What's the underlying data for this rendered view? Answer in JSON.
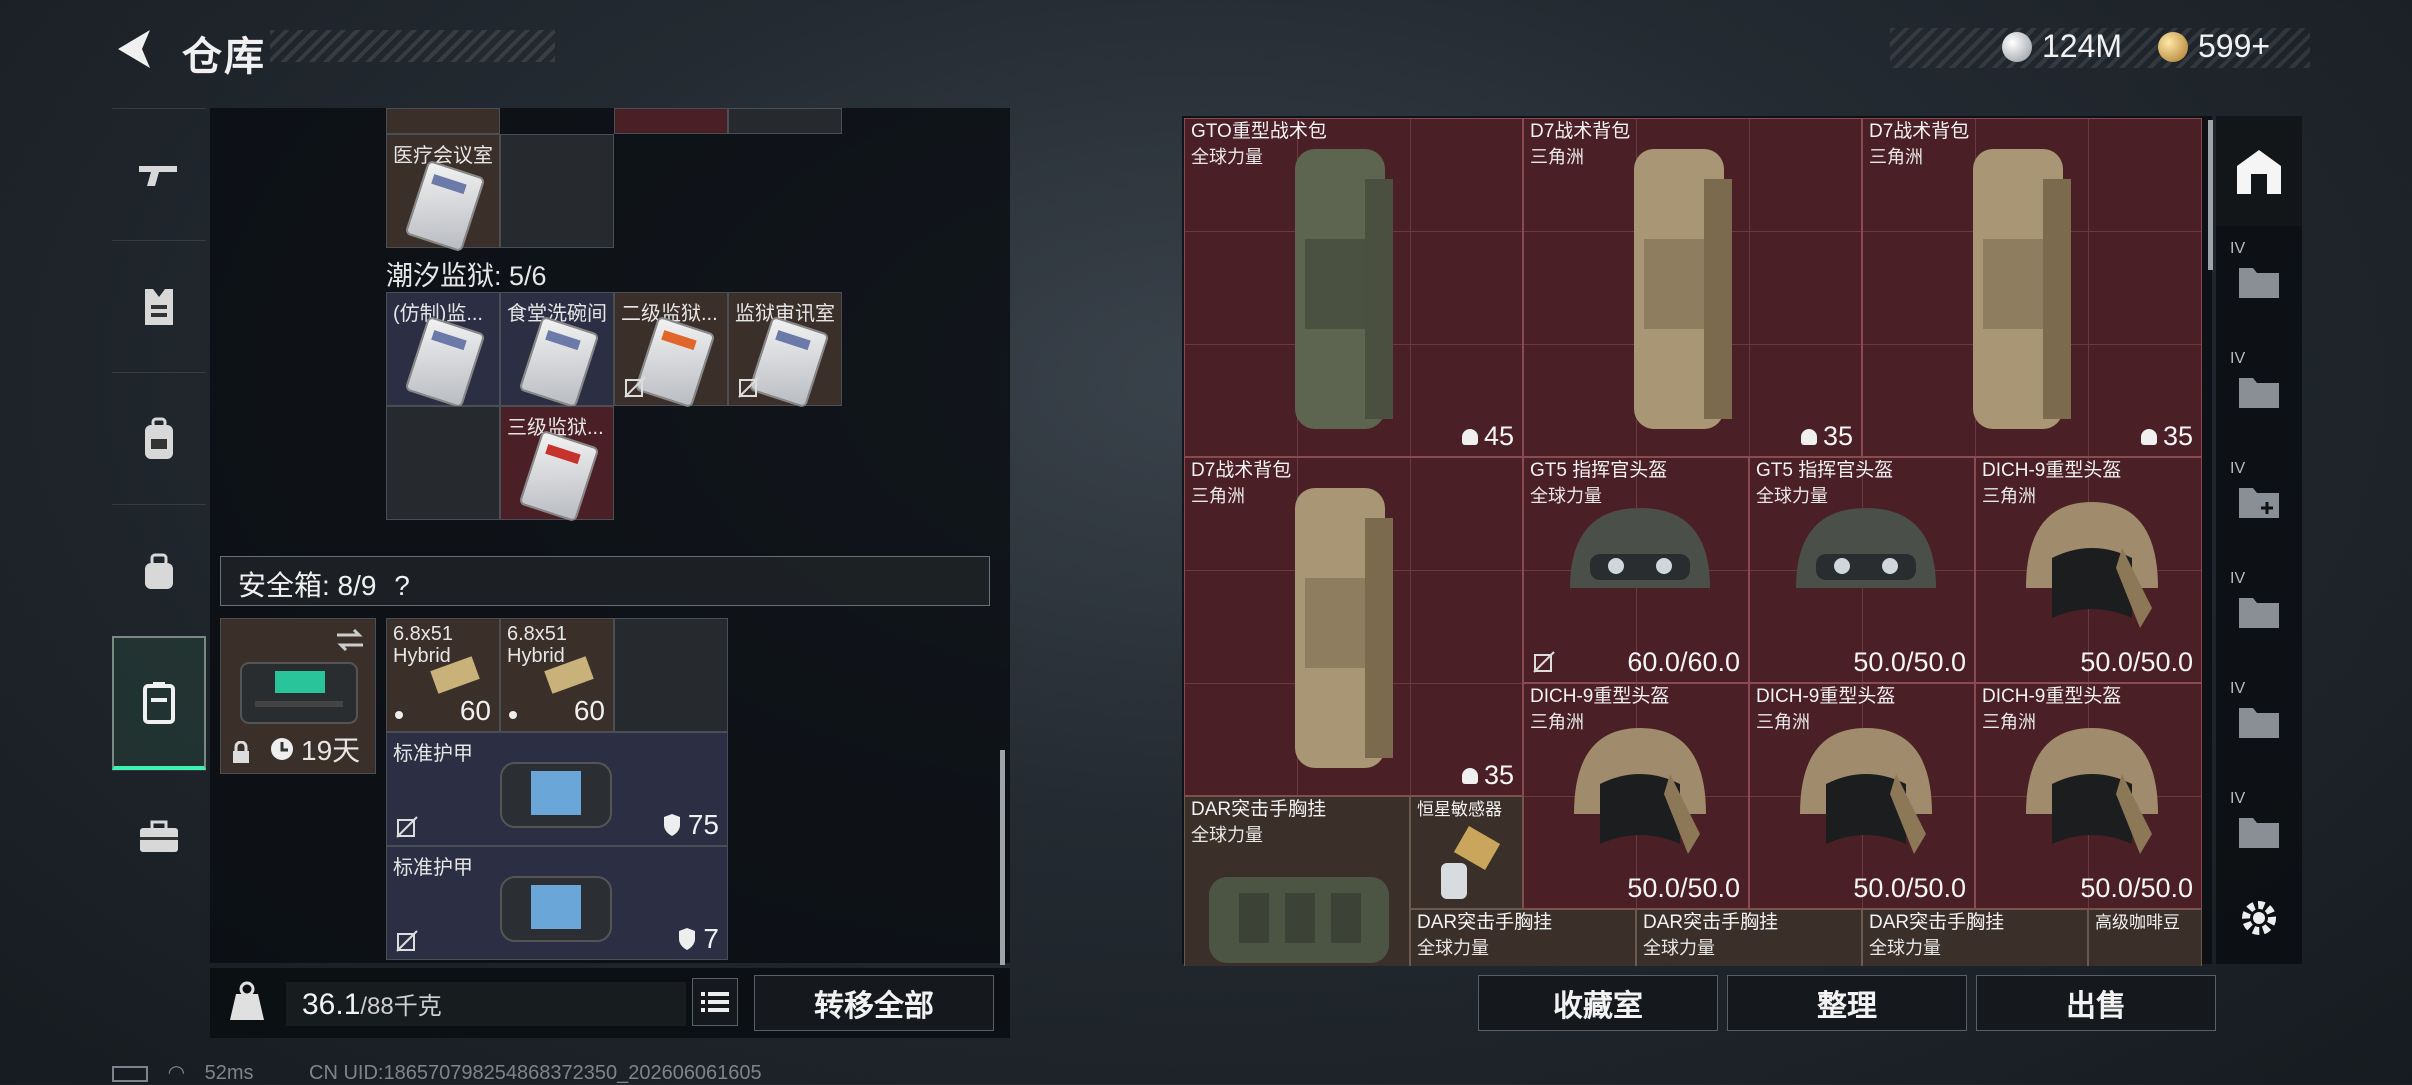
{
  "header": {
    "title": "仓库",
    "currency_1_value": "124M",
    "currency_2_value": "599+",
    "colors": {
      "accent_green": "#3ef2b0",
      "slot_red": "#4a1f25",
      "slot_brown": "#3b2f2a"
    }
  },
  "sidebar": {
    "items": [
      {
        "icon": "gun-icon"
      },
      {
        "icon": "vest-icon"
      },
      {
        "icon": "backpack-icon"
      },
      {
        "icon": "pouch-icon"
      },
      {
        "icon": "storage-case-icon",
        "active": true
      },
      {
        "icon": "briefcase-icon"
      }
    ]
  },
  "left": {
    "top_card_label": "医疗会议室",
    "prison_header": "潮汐监狱: 5/6",
    "prison_cards": [
      {
        "label": "(仿制)监..."
      },
      {
        "label": "食堂洗碗间"
      },
      {
        "label": "二级监狱..."
      },
      {
        "label": "监狱审讯室"
      },
      {
        "label": "三级监狱..."
      }
    ],
    "safe_header": "安全箱: 8/9",
    "safe_help": "?",
    "safe_timer": "19天",
    "ammo": [
      {
        "name": "6.8x51",
        "sub": "Hybrid",
        "count": "60"
      },
      {
        "name": "6.8x51",
        "sub": "Hybrid",
        "count": "60"
      }
    ],
    "armors": [
      {
        "name": "标准护甲",
        "durability": "75"
      },
      {
        "name": "标准护甲",
        "durability": "7"
      }
    ],
    "weight_current": "36.1",
    "weight_max": "/88千克",
    "transfer_all": "转移全部"
  },
  "stash": {
    "items": [
      {
        "name": "GTO重型战术包",
        "sub": "全球力量",
        "value": "45"
      },
      {
        "name": "D7战术背包",
        "sub": "三角洲",
        "value": "35"
      },
      {
        "name": "D7战术背包",
        "sub": "三角洲",
        "value": "35"
      },
      {
        "name": "D7战术背包",
        "sub": "三角洲",
        "value": "35"
      },
      {
        "name": "GT5 指挥官头盔",
        "sub": "全球力量",
        "value": "60.0/60.0"
      },
      {
        "name": "GT5 指挥官头盔",
        "sub": "全球力量",
        "value": "50.0/50.0"
      },
      {
        "name": "DICH-9重型头盔",
        "sub": "三角洲",
        "value": "50.0/50.0"
      },
      {
        "name": "DICH-9重型头盔",
        "sub": "三角洲",
        "value": "50.0/50.0"
      },
      {
        "name": "DICH-9重型头盔",
        "sub": "三角洲",
        "value": "50.0/50.0"
      },
      {
        "name": "DICH-9重型头盔",
        "sub": "三角洲",
        "value": "50.0/50.0"
      },
      {
        "name": "DAR突击手胸挂",
        "sub": "全球力量"
      },
      {
        "name": "恒星敏感器"
      },
      {
        "name": "DAR突击手胸挂",
        "sub": "全球力量"
      },
      {
        "name": "DAR突击手胸挂",
        "sub": "全球力量"
      },
      {
        "name": "DAR突击手胸挂",
        "sub": "全球力量"
      },
      {
        "name": "高级咖啡豆"
      }
    ],
    "rail_tag": "IV",
    "buttons": {
      "collection": "收藏室",
      "sort": "整理",
      "sell": "出售"
    }
  },
  "status": {
    "ping": "52ms",
    "uid": "CN UID:186570798254868372350_202606061605"
  }
}
